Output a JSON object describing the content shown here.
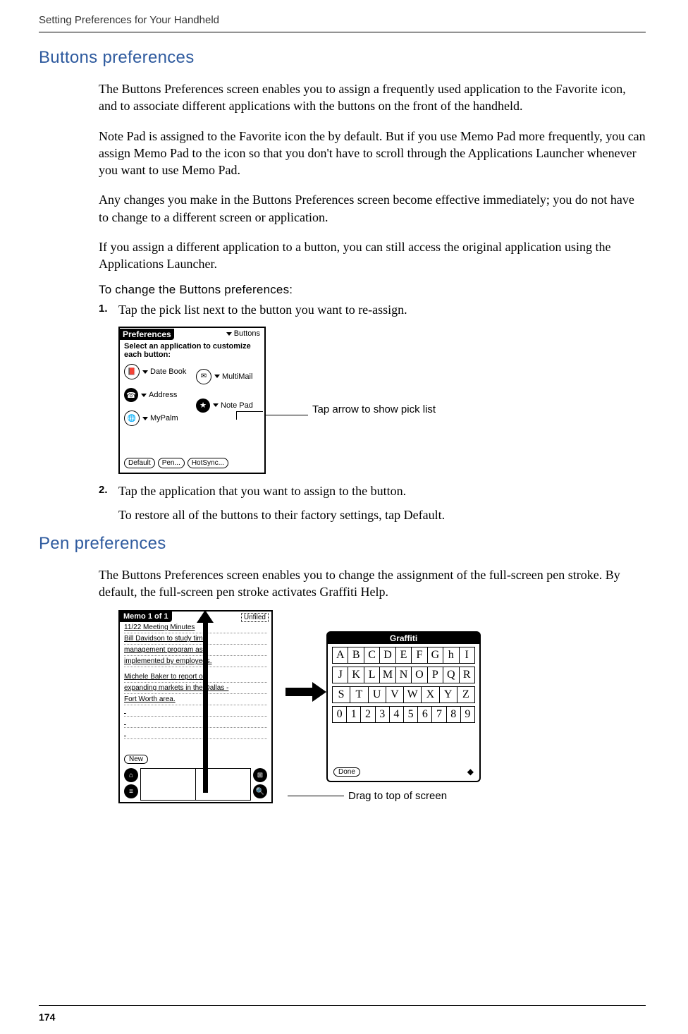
{
  "header": "Setting Preferences for Your Handheld",
  "section1_title": "Buttons preferences",
  "para1": "The Buttons Preferences screen enables you to assign a frequently used application to the Favorite icon, and to associate different applications with the buttons on the front of the handheld.",
  "para2": "Note Pad is assigned to the Favorite icon the  by default. But if you use Memo Pad more frequently, you can assign Memo Pad to the icon so that you don't have to scroll through the Applications Launcher whenever you want to use Memo Pad.",
  "para3": "Any changes you make in the Buttons Preferences screen become effective immediately; you do not have to change to a different screen or application.",
  "para4": "If you assign a different application to a button, you can still access the original application using the Applications Launcher.",
  "sub_heading": "To change the Buttons preferences:",
  "step1_num": "1.",
  "step1_text": "Tap the pick list next to the button you want to re-assign.",
  "step2_num": "2.",
  "step2_text": "Tap the application that you want to assign to the button.",
  "step2_sub": "To restore all of the buttons to their factory settings, tap Default.",
  "prefs": {
    "title": "Preferences",
    "category": "Buttons",
    "instruction": "Select an application to customize each button:",
    "left_items": [
      "Date Book",
      "Address",
      "MyPalm"
    ],
    "right_items": [
      "MultiMail",
      "Note Pad"
    ],
    "buttons": [
      "Default",
      "Pen...",
      "HotSync..."
    ]
  },
  "callout1": "Tap arrow to show pick list",
  "section2_title": "Pen preferences",
  "para5": "The Buttons Preferences screen enables you to change the assignment of the full-screen pen stroke. By default, the full-screen pen stroke activates Graffiti Help.",
  "memo": {
    "title": "Memo 1 of 1",
    "category": "Unfiled",
    "line1": "11/22 Meeting Minutes",
    "line2": "Bill Davidson to study time",
    "line3": "management program as",
    "line4": "implemented by employees.",
    "line5": "Michele Baker to report on",
    "line6": "expanding markets in the Dallas -",
    "line7": "Fort Worth area.",
    "new_btn": "New"
  },
  "graffiti": {
    "title": "Graffiti",
    "row1": [
      "A",
      "B",
      "C",
      "D",
      "E",
      "F",
      "G",
      "h",
      "I"
    ],
    "row2": [
      "J",
      "K",
      "L",
      "M",
      "N",
      "O",
      "P",
      "Q",
      "R"
    ],
    "row3": [
      "S",
      "T",
      "U",
      "V",
      "W",
      "X",
      "Y",
      "Z"
    ],
    "row4": [
      "0",
      "1",
      "2",
      "3",
      "4",
      "5",
      "6",
      "7",
      "8",
      "9"
    ],
    "done": "Done"
  },
  "callout2": "Drag to top of screen",
  "page_number": "174"
}
